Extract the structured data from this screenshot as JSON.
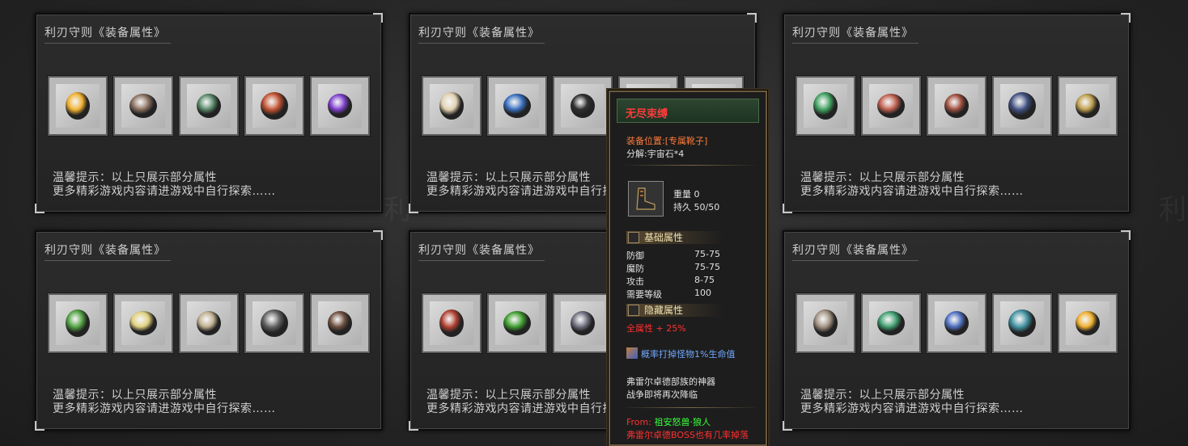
{
  "panels": [
    {
      "title": "利刃守则《装备属性》",
      "tip1": "温馨提示：以上只展示部分属性",
      "tip2": "更多精彩游戏内容请进游戏中自行探索……"
    },
    {
      "title": "利刃守则《装备属性》",
      "tip1": "温馨提示：以上只展示部分属性",
      "tip2": "更多精彩游戏内容请进游戏中自行探索……"
    },
    {
      "title": "利刃守则《装备属性》",
      "tip1": "温馨提示：以上只展示部分属性",
      "tip2": "更多精彩游戏内容请进游戏中自行探索……"
    },
    {
      "title": "利刃守则《装备属性》",
      "tip1": "温馨提示：以上只展示部分属性",
      "tip2": "更多精彩游戏内容请进游戏中自行探索……"
    },
    {
      "title": "利刃守则《装备属性》",
      "tip1": "温馨提示：以上只展示部分属性",
      "tip2": "更多精彩游戏内容请进游戏中自行探索……"
    },
    {
      "title": "利刃守则《装备属性》",
      "tip1": "温馨提示：以上只展示部分属性",
      "tip2": "更多精彩游戏内容请进游戏中自行探索……"
    }
  ],
  "slot_colors": [
    [
      "#f0b030",
      "#8a7060",
      "#5a8a6a",
      "#c05030",
      "#8040d0"
    ],
    [
      "#e0d0b0",
      "#3a70c0",
      "#303030",
      "#b04030",
      "#b0b0b0"
    ],
    [
      "#40a060",
      "#c06050",
      "#a05040",
      "#405080",
      "#c0a050"
    ],
    [
      "#50a040",
      "#e0d080",
      "#c0b090",
      "#606060",
      "#705040"
    ],
    [
      "#b04030",
      "#40a030",
      "#707080",
      "#808080",
      "#909090"
    ],
    [
      "#a09080",
      "#40a070",
      "#5070c0",
      "#4090a0",
      "#f0b030"
    ]
  ],
  "tooltip": {
    "name": "无尽束缚",
    "position": "装备位置:[专属靴子]",
    "decompose": "分解:宇宙石*4",
    "weight": "重量 0",
    "durability": "持久 50/50",
    "basic_title": "基础属性",
    "stats": [
      {
        "label": "防御",
        "value": "75-75"
      },
      {
        "label": "魔防",
        "value": "75-75"
      },
      {
        "label": "攻击",
        "value": "8-75"
      },
      {
        "label": "需要等级",
        "value": "100"
      }
    ],
    "hidden_title": "隐藏属性",
    "all_attr": "全属性 + 25%",
    "drop_chance": "概率打掉怪物1%生命值",
    "lore1": "弗雷尔卓德部族的神器",
    "lore2": "战争即将再次降临",
    "from_label": "From:",
    "from_value": "祖安怒兽·狼人",
    "drop_note": "弗雷尔卓德BOSS也有几率掉落"
  },
  "watermark": "利"
}
